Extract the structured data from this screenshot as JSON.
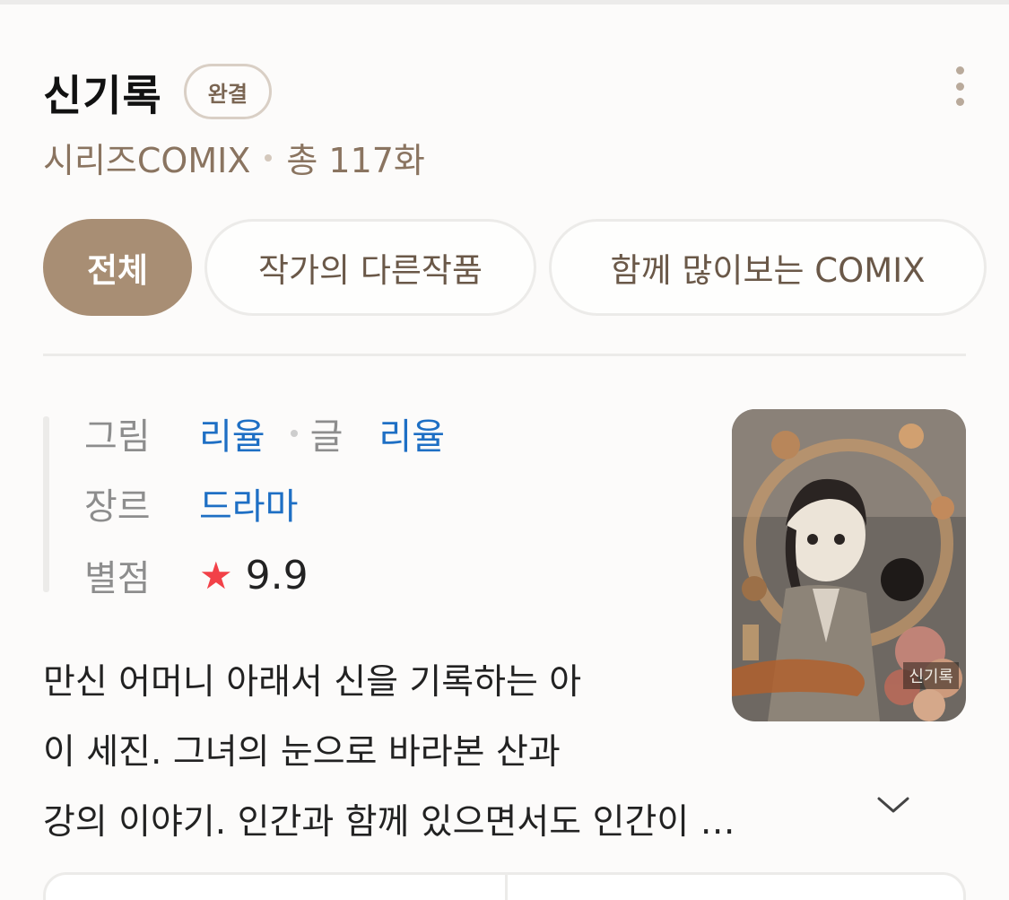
{
  "header": {
    "title": "신기록",
    "status_badge": "완결",
    "publisher": "시리즈COMIX",
    "episode_count": "총 117화"
  },
  "tabs": [
    {
      "label": "전체",
      "active": true
    },
    {
      "label": "작가의 다른작품",
      "active": false
    },
    {
      "label": "함께 많이보는 COMIX",
      "active": false
    }
  ],
  "info": {
    "art_label": "그림",
    "art_value": "리율",
    "story_label": "글",
    "story_value": "리율",
    "genre_label": "장르",
    "genre_value": "드라마",
    "rating_label": "별점",
    "rating_value": "9.9"
  },
  "cover": {
    "title_text": "신기록"
  },
  "description": {
    "line1": "만신 어머니 아래서 신을 기록하는 아",
    "line2": "이 세진. 그녀의 눈으로 바라본 산과",
    "line3": "강의 이야기. 인간과 함께 있으면서도 인간이 …"
  },
  "colors": {
    "accent": "#a88e74",
    "link": "#1e6fc4",
    "star": "#f24148"
  },
  "icons": {
    "more": "more-vertical-icon",
    "expand": "chevron-down-icon",
    "star": "star-icon"
  }
}
